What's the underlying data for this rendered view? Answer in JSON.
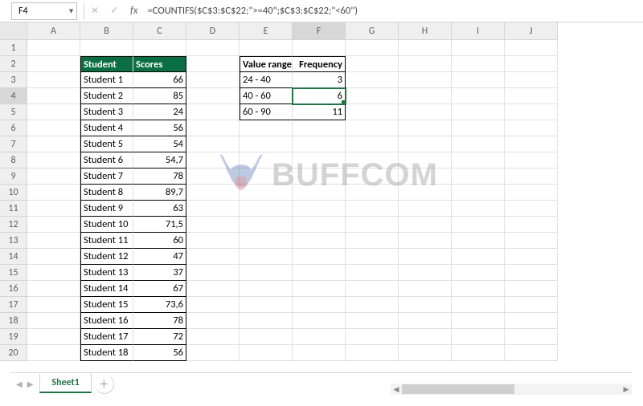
{
  "namebox": {
    "cell": "F4"
  },
  "formula": "=COUNTIFS($C$3:$C$22;\">=40\";$C$3:$C$22;\"<60\")",
  "columns": [
    "A",
    "B",
    "C",
    "D",
    "E",
    "F",
    "G",
    "H",
    "I",
    "J"
  ],
  "data_table": {
    "headers": {
      "b": "Student",
      "c": "Scores"
    },
    "rows": [
      {
        "b": "Student 1",
        "c": "66"
      },
      {
        "b": "Student 2",
        "c": "85"
      },
      {
        "b": "Student 3",
        "c": "24"
      },
      {
        "b": "Student 4",
        "c": "56"
      },
      {
        "b": "Student 5",
        "c": "54"
      },
      {
        "b": "Student 6",
        "c": "54,7"
      },
      {
        "b": "Student 7",
        "c": "78"
      },
      {
        "b": "Student 8",
        "c": "89,7"
      },
      {
        "b": "Student 9",
        "c": "63"
      },
      {
        "b": "Student 10",
        "c": "71,5"
      },
      {
        "b": "Student 11",
        "c": "60"
      },
      {
        "b": "Student 12",
        "c": "47"
      },
      {
        "b": "Student 13",
        "c": "37"
      },
      {
        "b": "Student 14",
        "c": "67"
      },
      {
        "b": "Student 15",
        "c": "73,6"
      },
      {
        "b": "Student 16",
        "c": "78"
      },
      {
        "b": "Student 17",
        "c": "72"
      },
      {
        "b": "Student 18",
        "c": "56"
      }
    ]
  },
  "freq_table": {
    "headers": {
      "e": "Value range",
      "f": "Frequency"
    },
    "rows": [
      {
        "e": "24 - 40",
        "f": "3"
      },
      {
        "e": "40 - 60",
        "f": "6"
      },
      {
        "e": "60 - 90",
        "f": "11"
      }
    ]
  },
  "active_cell_value": "6",
  "sheet_tab": "Sheet1",
  "watermark": "BUFFCOM"
}
